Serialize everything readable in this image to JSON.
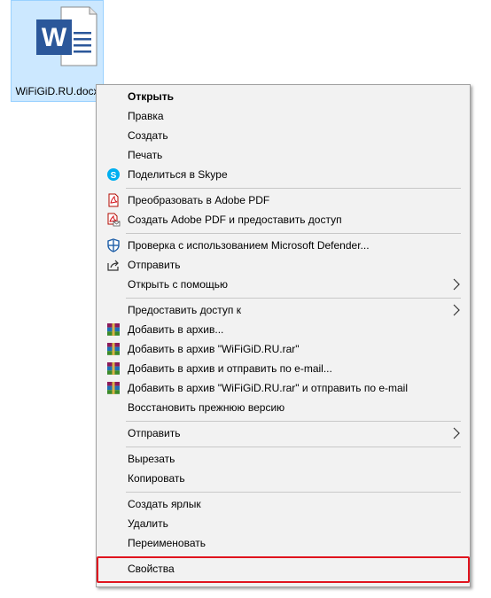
{
  "desktop": {
    "file_name": "WiFiGiD.RU.docx",
    "file_type_letter": "W"
  },
  "menu": {
    "items": [
      {
        "label": "Открыть",
        "icon": null,
        "bold": true
      },
      {
        "label": "Правка",
        "icon": null
      },
      {
        "label": "Создать",
        "icon": null
      },
      {
        "label": "Печать",
        "icon": null
      },
      {
        "label": "Поделиться в Skype",
        "icon": "skype-icon"
      },
      {
        "label": "Преобразовать в Adobe PDF",
        "icon": "adobe-pdf-icon"
      },
      {
        "label": "Создать Adobe PDF и предоставить доступ",
        "icon": "adobe-pdf-share-icon"
      },
      {
        "label": "Проверка с использованием Microsoft Defender...",
        "icon": "defender-shield-icon"
      },
      {
        "label": "Отправить",
        "icon": "share-icon"
      },
      {
        "label": "Открыть с помощью",
        "icon": null,
        "submenu": true
      },
      {
        "label": "Предоставить доступ к",
        "icon": null,
        "submenu": true
      },
      {
        "label": "Добавить в архив...",
        "icon": "winrar-icon"
      },
      {
        "label": "Добавить в архив \"WiFiGiD.RU.rar\"",
        "icon": "winrar-icon"
      },
      {
        "label": "Добавить в архив и отправить по e-mail...",
        "icon": "winrar-icon"
      },
      {
        "label": "Добавить в архив \"WiFiGiD.RU.rar\" и отправить по e-mail",
        "icon": "winrar-icon"
      },
      {
        "label": "Восстановить прежнюю версию",
        "icon": null
      },
      {
        "label": "Отправить",
        "icon": null,
        "submenu": true
      },
      {
        "label": "Вырезать",
        "icon": null
      },
      {
        "label": "Копировать",
        "icon": null
      },
      {
        "label": "Создать ярлык",
        "icon": null
      },
      {
        "label": "Удалить",
        "icon": null
      },
      {
        "label": "Переименовать",
        "icon": null
      },
      {
        "label": "Свойства",
        "icon": null,
        "highlighted": true
      }
    ]
  },
  "colors": {
    "menu_bg": "#f2f2f2",
    "selection_bg": "#cce8ff",
    "word_blue": "#2b579a",
    "highlight_red": "#e0141e"
  }
}
